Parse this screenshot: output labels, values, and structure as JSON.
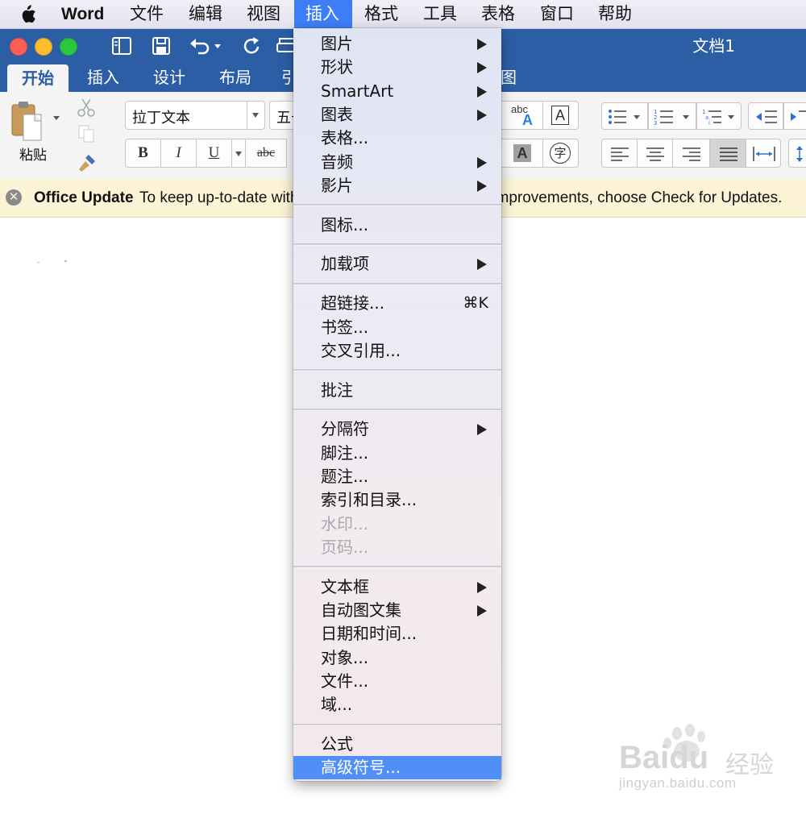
{
  "menubar": {
    "app_name": "Word",
    "items": [
      "文件",
      "编辑",
      "视图",
      "插入",
      "格式",
      "工具",
      "表格",
      "窗口",
      "帮助"
    ],
    "active": "插入"
  },
  "window": {
    "title": "文档1"
  },
  "ribbon": {
    "tabs": [
      "开始",
      "插入",
      "设计",
      "布局",
      "引",
      "图"
    ],
    "active_tab": "开始",
    "paste_label": "粘贴",
    "font_name": "拉丁文本",
    "font_size": "五号",
    "bold": "B",
    "italic": "I",
    "underline": "U",
    "strikethrough": "abc",
    "text_effects": "abc",
    "char_border": "A",
    "char_shading": "A",
    "phonetic": "字"
  },
  "update_bar": {
    "title": "Office Update",
    "text": "To keep up-to-date with security updates, fixes, and improvements, choose Check for Updates."
  },
  "insert_menu": {
    "groups": [
      [
        {
          "label": "图片",
          "submenu": true
        },
        {
          "label": "形状",
          "submenu": true
        },
        {
          "label": "SmartArt",
          "submenu": true
        },
        {
          "label": "图表",
          "submenu": true
        },
        {
          "label": "表格..."
        },
        {
          "label": "音频",
          "submenu": true
        },
        {
          "label": "影片",
          "submenu": true
        }
      ],
      [
        {
          "label": "图标..."
        }
      ],
      [
        {
          "label": "加载项",
          "submenu": true
        }
      ],
      [
        {
          "label": "超链接...",
          "shortcut": "⌘K"
        },
        {
          "label": "书签..."
        },
        {
          "label": "交叉引用..."
        }
      ],
      [
        {
          "label": "批注"
        }
      ],
      [
        {
          "label": "分隔符",
          "submenu": true
        },
        {
          "label": "脚注..."
        },
        {
          "label": "题注..."
        },
        {
          "label": "索引和目录..."
        },
        {
          "label": "水印...",
          "disabled": true
        },
        {
          "label": "页码...",
          "disabled": true
        }
      ],
      [
        {
          "label": "文本框",
          "submenu": true
        },
        {
          "label": "自动图文集",
          "submenu": true
        },
        {
          "label": "日期和时间..."
        },
        {
          "label": "对象..."
        },
        {
          "label": "文件..."
        },
        {
          "label": "域..."
        }
      ],
      [
        {
          "label": "公式"
        },
        {
          "label": "高级符号...",
          "highlighted": true
        }
      ]
    ]
  },
  "watermark": {
    "brand": "Baidu",
    "brand_cn": "经验",
    "url": "jingyan.baidu.com"
  },
  "colors": {
    "accent": "#2c5ea5",
    "menu_highlight": "#4f8ff7",
    "menubar_active": "#3d7df6"
  }
}
